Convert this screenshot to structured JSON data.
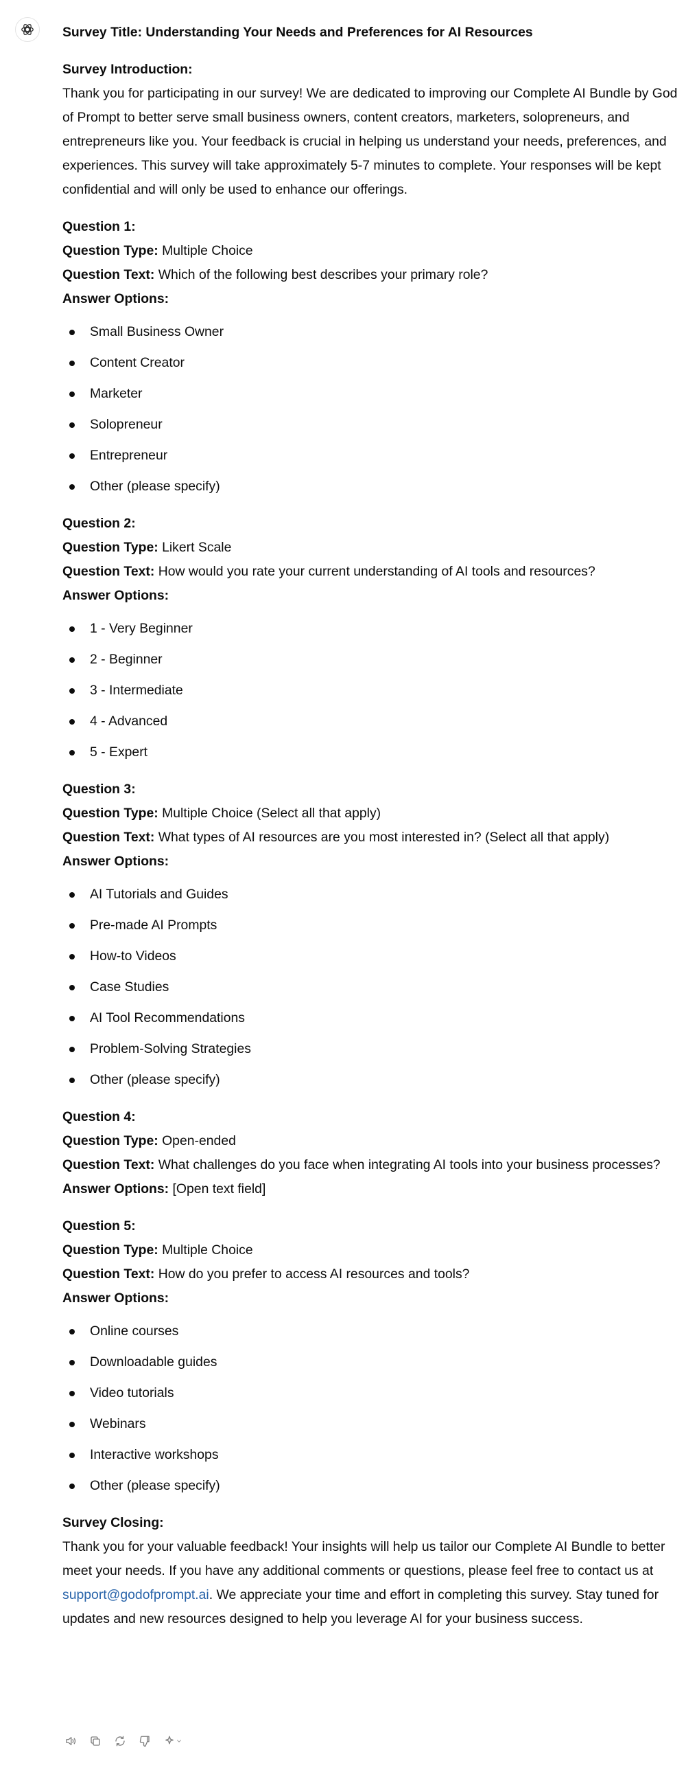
{
  "message": {
    "title": "Survey Title: Understanding Your Needs and Preferences for AI Resources",
    "intro_heading": "Survey Introduction:",
    "intro_text": "Thank you for participating in our survey! We are dedicated to improving our Complete AI Bundle by God of Prompt to better serve small business owners, content creators, marketers, solopreneurs, and entrepreneurs like you. Your feedback is crucial in helping us understand your needs, preferences, and experiences. This survey will take approximately 5-7 minutes to complete. Your responses will be kept confidential and will only be used to enhance our offerings.",
    "labels": {
      "type": "Question Type:",
      "text": "Question Text:",
      "options": "Answer Options:"
    },
    "questions": [
      {
        "heading": "Question 1:",
        "type": "Multiple Choice",
        "text": "Which of the following best describes your primary role?",
        "options": [
          "Small Business Owner",
          "Content Creator",
          "Marketer",
          "Solopreneur",
          "Entrepreneur",
          "Other (please specify)"
        ]
      },
      {
        "heading": "Question 2:",
        "type": "Likert Scale",
        "text": "How would you rate your current understanding of AI tools and resources?",
        "options": [
          "1 - Very Beginner",
          "2 - Beginner",
          "3 - Intermediate",
          "4 - Advanced",
          "5 - Expert"
        ]
      },
      {
        "heading": "Question 3:",
        "type": "Multiple Choice (Select all that apply)",
        "text": "What types of AI resources are you most interested in? (Select all that apply)",
        "options": [
          "AI Tutorials and Guides",
          "Pre-made AI Prompts",
          "How-to Videos",
          "Case Studies",
          "AI Tool Recommendations",
          "Problem-Solving Strategies",
          "Other (please specify)"
        ]
      },
      {
        "heading": "Question 4:",
        "type": "Open-ended",
        "text": "What challenges do you face when integrating AI tools into your business processes?",
        "options_inline": "[Open text field]"
      },
      {
        "heading": "Question 5:",
        "type": "Multiple Choice",
        "text": "How do you prefer to access AI resources and tools?",
        "options": [
          "Online courses",
          "Downloadable guides",
          "Video tutorials",
          "Webinars",
          "Interactive workshops",
          "Other (please specify)"
        ]
      }
    ],
    "closing_heading": "Survey Closing:",
    "closing_text_1": "Thank you for your valuable feedback! Your insights will help us tailor our Complete AI Bundle to better meet your needs. If you have any additional comments or questions, please feel free to contact us at ",
    "closing_email": "support@godofprompt.ai",
    "closing_text_2": ". We appreciate your time and effort in completing this survey. Stay tuned for updates and new resources designed to help you leverage AI for your business success."
  },
  "actions": {
    "icons": [
      "speaker-icon",
      "copy-icon",
      "regenerate-icon",
      "thumbs-down-icon",
      "model-switch-icon"
    ]
  },
  "colors": {
    "text": "#0d0d0d",
    "link": "#2964aa",
    "icon": "#7d7d7d"
  }
}
